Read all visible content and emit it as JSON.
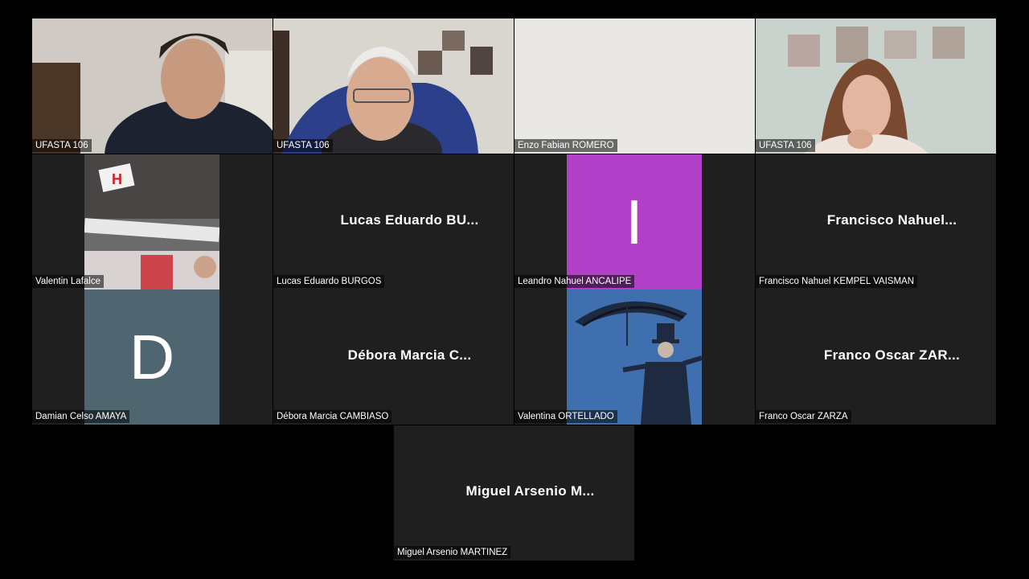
{
  "participants": [
    {
      "name": "UFASTA 106"
    },
    {
      "name": "UFASTA 106"
    },
    {
      "name": "Enzo Fabian ROMERO"
    },
    {
      "name": "UFASTA 106"
    },
    {
      "name": "Valentin Lafalce"
    },
    {
      "name": "Lucas Eduardo BURGOS",
      "display": "Lucas Eduardo BU..."
    },
    {
      "name": "Leandro Nahuel ANCALIPE",
      "avatar_letter": "I"
    },
    {
      "name": "Francisco Nahuel KEMPEL VAISMAN",
      "display": "Francisco Nahuel..."
    },
    {
      "name": "Damian Celso AMAYA",
      "avatar_letter": "D"
    },
    {
      "name": "Débora Marcia CAMBIASO",
      "display": "Débora Marcia C..."
    },
    {
      "name": "Valentina ORTELLADO"
    },
    {
      "name": "Franco Oscar ZARZA",
      "display": "Franco Oscar ZAR..."
    },
    {
      "name": "Miguel Arsenio MARTINEZ",
      "display": "Miguel Arsenio M..."
    }
  ],
  "colors": {
    "tile_bg": "#1f1f1f",
    "avatar_purple": "#b23fc7",
    "avatar_slate": "#4f6670"
  }
}
